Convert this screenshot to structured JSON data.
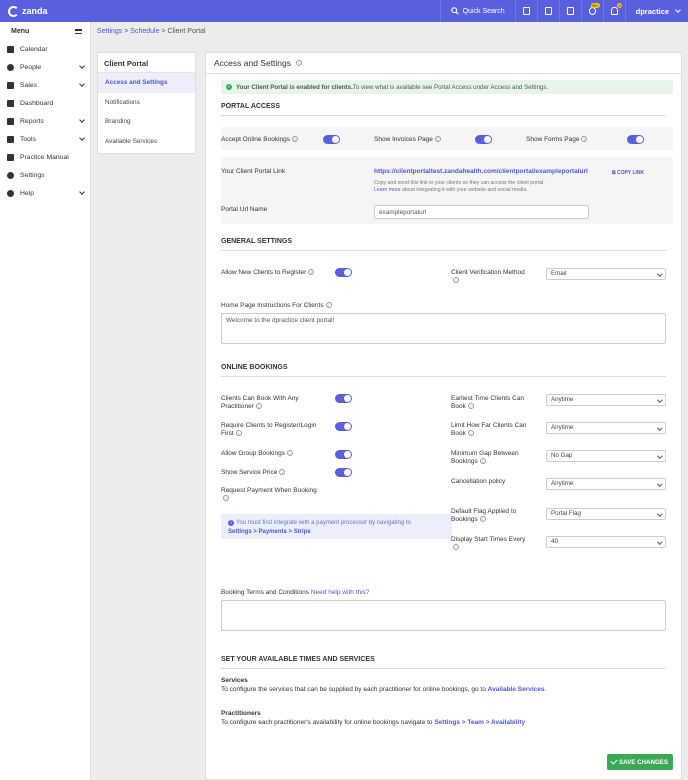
{
  "app": {
    "logo": "zanda",
    "quick_search": "Quick Search",
    "user": "dpractice",
    "badges": [
      "99+",
      "9"
    ]
  },
  "sidebar": {
    "menu_label": "Menu",
    "items": [
      {
        "label": "Calendar",
        "icon": "calendar-icon",
        "chevron": false
      },
      {
        "label": "People",
        "icon": "people-icon",
        "chevron": true
      },
      {
        "label": "Sales",
        "icon": "sales-icon",
        "chevron": true
      },
      {
        "label": "Dashboard",
        "icon": "dashboard-icon",
        "chevron": false
      },
      {
        "label": "Reports",
        "icon": "reports-icon",
        "chevron": true
      },
      {
        "label": "Tools",
        "icon": "tools-icon",
        "chevron": true
      },
      {
        "label": "Practice Manual",
        "icon": "manual-icon",
        "chevron": false
      },
      {
        "label": "Settings",
        "icon": "gear-icon",
        "chevron": false
      },
      {
        "label": "Help",
        "icon": "help-icon",
        "chevron": true
      }
    ]
  },
  "breadcrumb": {
    "settings": "Settings",
    "sep": " > ",
    "schedule": "Schedule",
    "current": "Client Portal"
  },
  "subnav": {
    "title": "Client Portal",
    "items": [
      "Access and Settings",
      "Notifications",
      "Branding",
      "Available Services"
    ]
  },
  "panel": {
    "title": "Access and Settings",
    "alert": {
      "bold": "Your Client Portal is enabled for clients.",
      "rest": " To view what is available see Portal Access under Access and Settings."
    },
    "portal_access": {
      "heading": "PORTAL ACCESS",
      "accept": "Accept Online Bookings",
      "invoices": "Show Invoices Page",
      "forms": "Show Forms Page",
      "link_label": "Your Client Portal Link",
      "link": "https://clientportaltest.zandahealth.com/clientportal/exampleportalurl",
      "copy": "COPY LINK",
      "help1": "Copy and send this link to your clients so they can access the client portal.",
      "learn_more": "Learn more",
      "help2": " about integrating it with your website and social media.",
      "url_label": "Portal Url Name",
      "url_value": "exampleportalurl"
    },
    "general": {
      "heading": "GENERAL SETTINGS",
      "allow_new": "Allow New Clients to Register",
      "verification": "Client Verification Method",
      "verification_value": "Email",
      "home_label": "Home Page Instructions For Clients",
      "home_value": "Welcome to the dpractice client portal!"
    },
    "online": {
      "heading": "ONLINE BOOKINGS",
      "any_pract": "Clients Can Book With Any Practitioner",
      "require": "Require Clients to Register/Login First",
      "group": "Allow Group Bookings",
      "price": "Show Service Price",
      "payment": "Request Payment When Booking",
      "earliest": "Earliest Time Clients Can Book",
      "earliest_value": "Anytime",
      "limit": "Limit How Far Clients Can Book",
      "limit_value": "Anytime",
      "gap": "Minimum Gap Between Bookings",
      "gap_value": "No Gap",
      "cancel": "Cancellation policy",
      "cancel_value": "Anytime",
      "flag": "Default Flag Applied to Bookings",
      "flag_value": "Portal Flag",
      "start": "Display Start Times Every",
      "start_value": "40",
      "hint": "You must first integrate with a payment processor by navigating to",
      "hint_link": "Settings > Payments > Stripe",
      "terms": "Booking Terms and Conditions",
      "terms_help": "Need help with this?"
    },
    "times": {
      "heading": "SET YOUR AVAILABLE TIMES AND SERVICES",
      "services_title": "Services",
      "services_text": "To configure the services that can be supplied by each practitioner for online bookings, go to ",
      "services_link": "Available Services",
      "services_end": ".",
      "pract_title": "Practitioners",
      "pract_text": "To configure each practitioner's availability for online bookings navigate to ",
      "pract_link": "Settings > Team > Availability"
    },
    "save": "SAVE CHANGES"
  }
}
